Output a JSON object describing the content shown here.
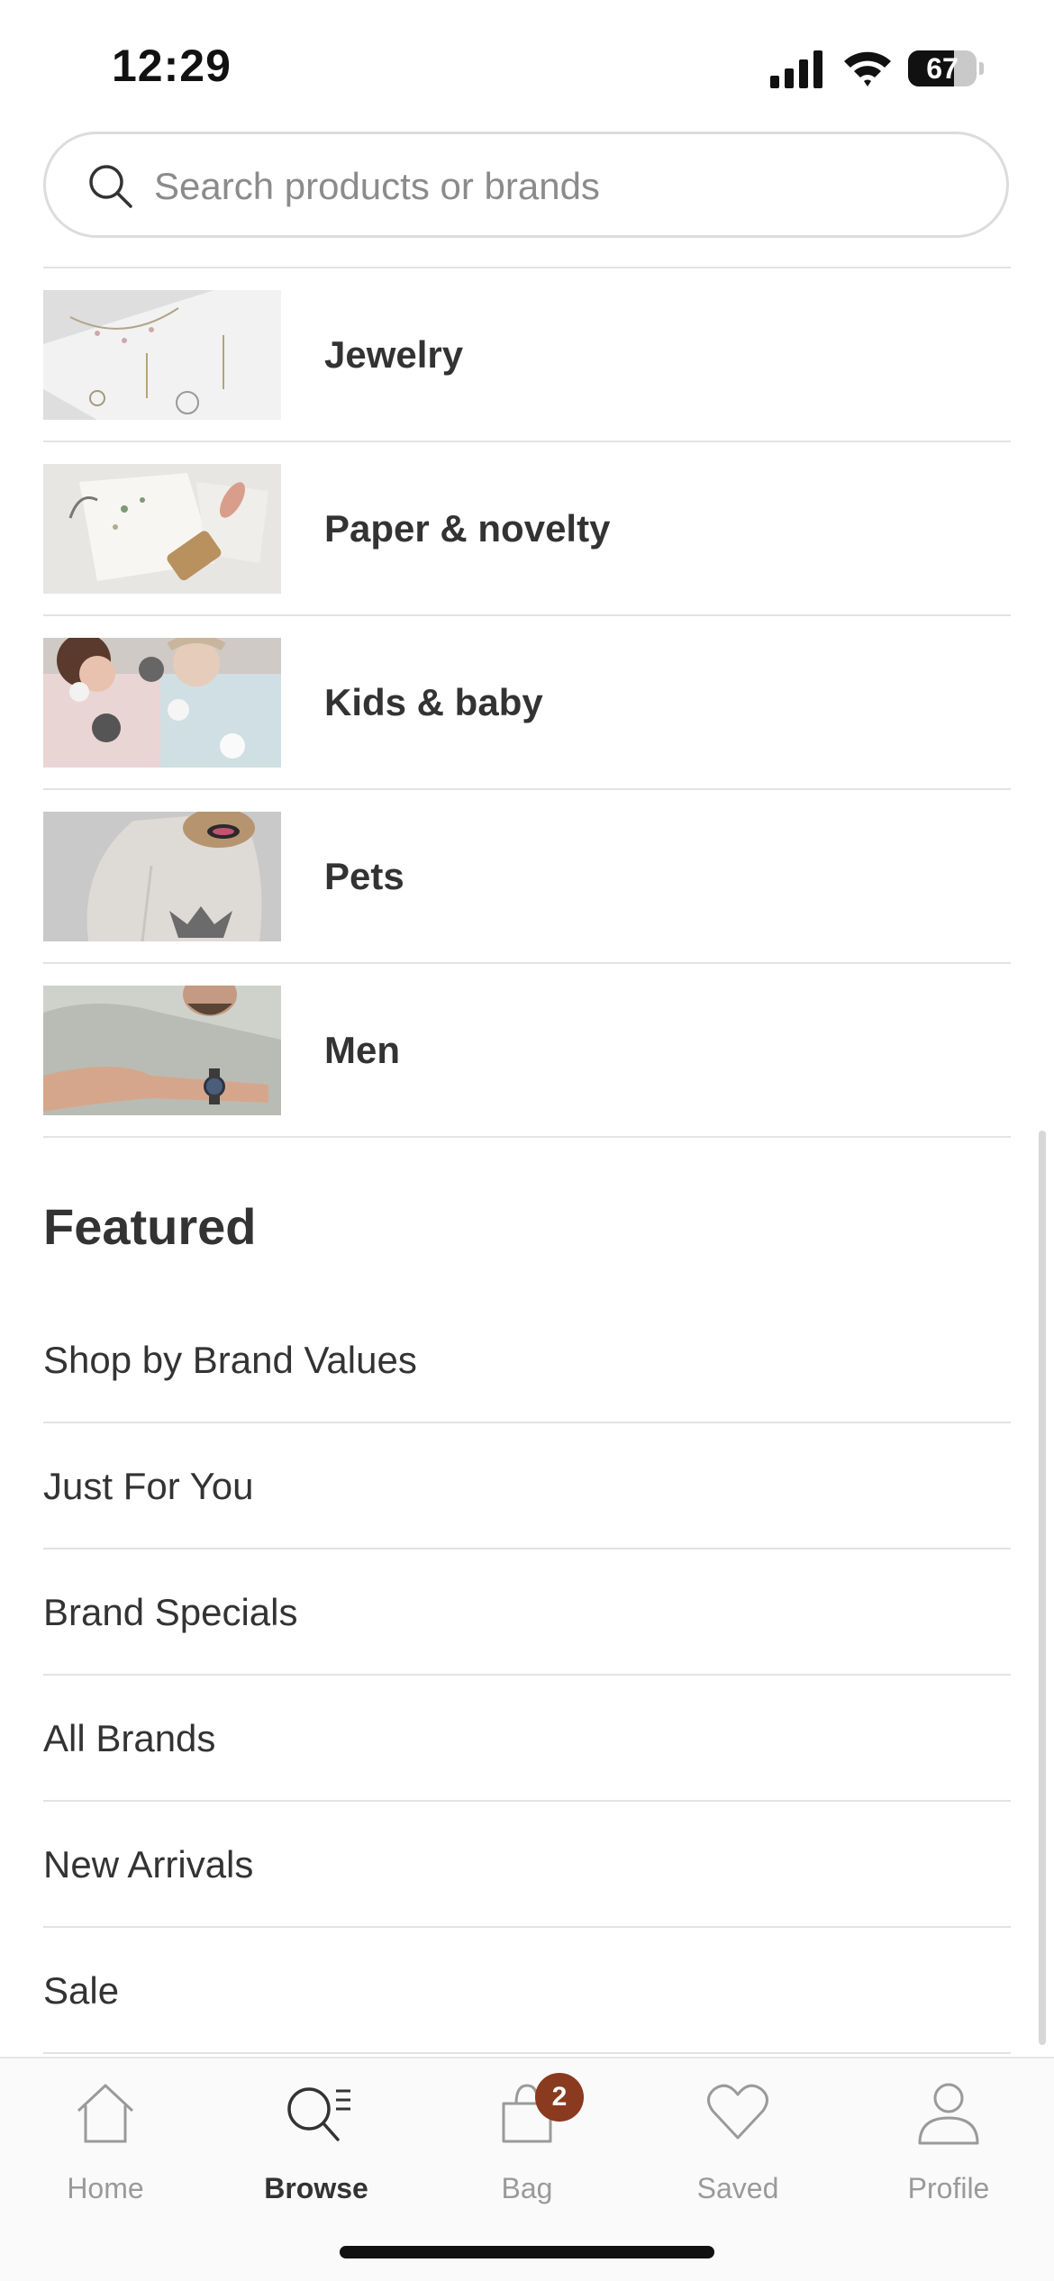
{
  "status_bar": {
    "time": "12:29",
    "battery": "67"
  },
  "search": {
    "placeholder": "Search products or brands"
  },
  "categories": [
    {
      "label": "Jewelry",
      "image": "jewelry-thumbnail"
    },
    {
      "label": "Paper & novelty",
      "image": "paper-novelty-thumbnail"
    },
    {
      "label": "Kids & baby",
      "image": "kids-baby-thumbnail"
    },
    {
      "label": "Pets",
      "image": "pets-thumbnail"
    },
    {
      "label": "Men",
      "image": "men-thumbnail"
    }
  ],
  "featured": {
    "title": "Featured",
    "items": [
      "Shop by Brand Values",
      "Just For You",
      "Brand Specials",
      "All Brands",
      "New Arrivals",
      "Sale"
    ]
  },
  "tab_bar": {
    "tabs": [
      {
        "label": "Home",
        "icon": "home-icon"
      },
      {
        "label": "Browse",
        "icon": "browse-icon",
        "active": true
      },
      {
        "label": "Bag",
        "icon": "bag-icon",
        "badge": "2"
      },
      {
        "label": "Saved",
        "icon": "heart-icon"
      },
      {
        "label": "Profile",
        "icon": "profile-icon"
      }
    ]
  },
  "colors": {
    "badge": "#8a3a1e",
    "divider": "#e3e3e3",
    "text": "#333333",
    "inactive": "#9a9a9a"
  }
}
